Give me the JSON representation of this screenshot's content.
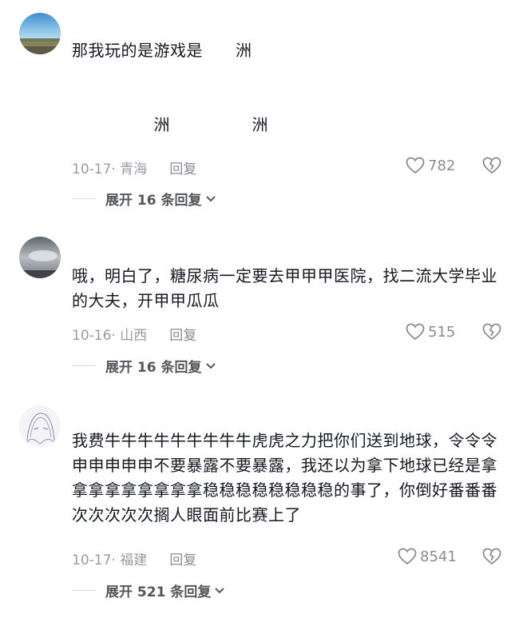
{
  "comments": [
    {
      "text": "那我玩的是游戏是　　洲\n\n\n　　　　　洲　　　　　洲",
      "time": "10-17· 青海",
      "reply_label": "回复",
      "likes": "782",
      "expand_label": "展开 16 条回复",
      "avatar": "landscape-avatar"
    },
    {
      "text": "哦，明白了，糖尿病一定要去甲甲甲医院，找二流大学毕业的大夫，开甲甲瓜瓜",
      "time": "10-16· 山西",
      "reply_label": "回复",
      "likes": "515",
      "expand_label": "展开 16 条回复",
      "avatar": "cloudy-sky-avatar"
    },
    {
      "text": "我费牛牛牛牛牛牛牛牛牛虎虎之力把你们送到地球，令令令申申申申申不要暴露不要暴露，我还以为拿下地球已经是拿拿拿拿拿拿拿拿拿稳稳稳稳稳稳稳稳的事了，你倒好番番番次次次次次搁人眼面前比赛上了",
      "time": "10-17· 福建",
      "reply_label": "回复",
      "likes": "8541",
      "expand_label": "展开 521 条回复",
      "avatar": "anime-sketch-avatar"
    }
  ],
  "colors": {
    "text": "#161823",
    "meta": "#9a9ba2",
    "expand": "#55565c"
  },
  "icons": {
    "like": "heart-outline-icon",
    "dislike": "broken-heart-icon",
    "expand": "chevron-down-icon"
  }
}
